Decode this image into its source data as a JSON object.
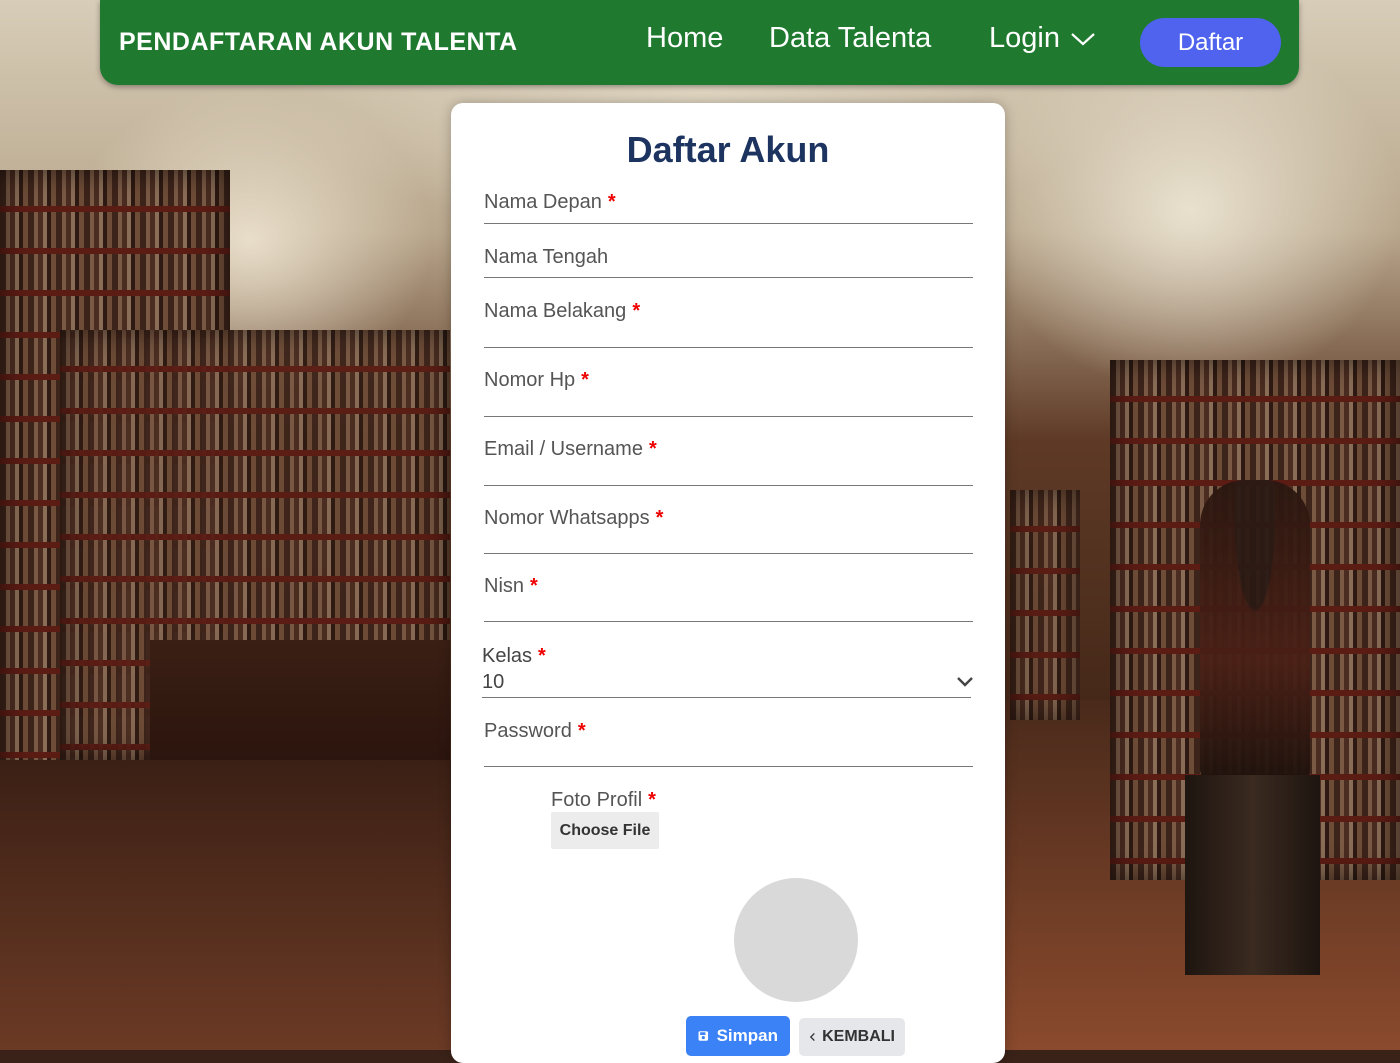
{
  "navbar": {
    "brand": "PENDAFTARAN AKUN TALENTA",
    "home": "Home",
    "data_talenta": "Data Talenta",
    "login": "Login",
    "daftar": "Daftar"
  },
  "form": {
    "title": "Daftar Akun",
    "required_mark": "*",
    "fields": {
      "nama_depan": "Nama Depan",
      "nama_tengah": "Nama Tengah",
      "nama_belakang": "Nama Belakang",
      "nomor_hp": "Nomor Hp",
      "email": "Email / Username",
      "whatsapp": "Nomor Whatsapps",
      "nisn": "Nisn",
      "password": "Password"
    },
    "kelas": {
      "label": "Kelas",
      "value": "10"
    },
    "foto": {
      "label": "Foto Profil",
      "choose_file": "Choose File"
    },
    "buttons": {
      "simpan": "Simpan",
      "kembali": "KEMBALI"
    }
  },
  "colors": {
    "navbar": "#1f7a2f",
    "daftar_button": "#4f63ee",
    "title": "#1d3461",
    "simpan_button": "#3b82f6",
    "required": "#e00000"
  }
}
